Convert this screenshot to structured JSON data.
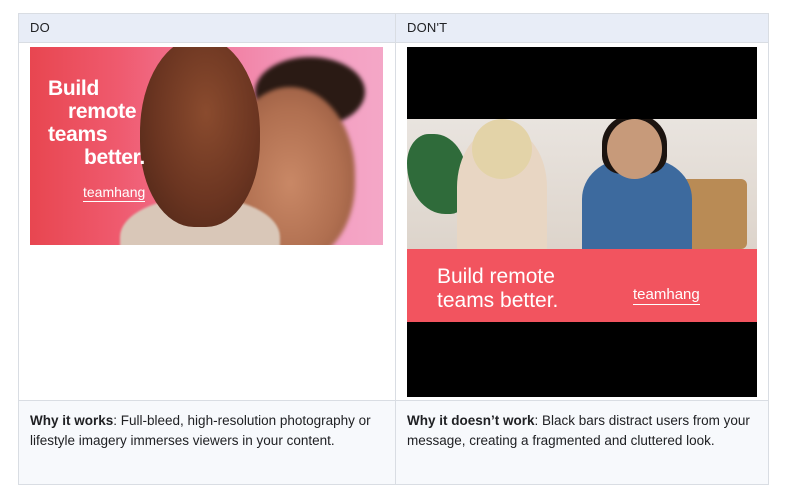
{
  "header": {
    "do_label": "DO",
    "dont_label": "DON'T"
  },
  "do_example": {
    "headline_lines": [
      "Build",
      "remote",
      "teams",
      "better."
    ],
    "logo": "teamhang",
    "caption_bold": "Why it works",
    "caption_text": ": Full-bleed, high-resolution photography or lifestyle imagery immerses viewers in your content."
  },
  "dont_example": {
    "headline_lines": [
      "Build remote",
      "teams better."
    ],
    "logo": "teamhang",
    "caption_bold": "Why it doesn’t work",
    "caption_text": ": Black bars distract users from your message, creating a fragmented and cluttered look."
  },
  "colors": {
    "header_bg": "#e8edf7",
    "brand_red": "#f2545f",
    "footer_bg": "#f7f9fc"
  }
}
